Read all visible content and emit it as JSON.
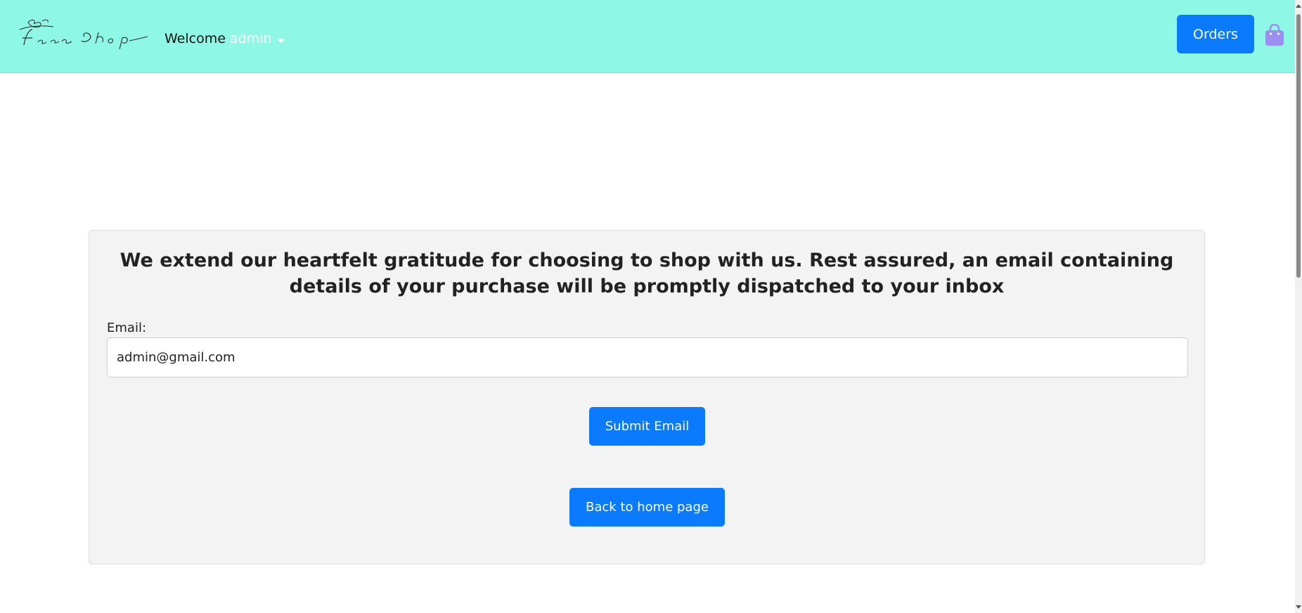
{
  "header": {
    "brand_text": "Face Shop",
    "welcome_prefix": "Welcome",
    "username": "admin",
    "orders_label": "Orders",
    "bag_icon": "shopping-bag-icon",
    "bag_color": "#9d8ff2",
    "background_color": "#8ff7e6"
  },
  "main": {
    "heading": "We extend our heartfelt gratitude for choosing to shop with us. Rest assured, an email containing details of your purchase will be promptly dispatched to your inbox",
    "email_label": "Email:",
    "email_value": "admin@gmail.com",
    "submit_label": "Submit Email",
    "home_label": "Back to home page"
  },
  "colors": {
    "primary_button": "#0a7bff",
    "card_background": "#f3f3f3"
  }
}
